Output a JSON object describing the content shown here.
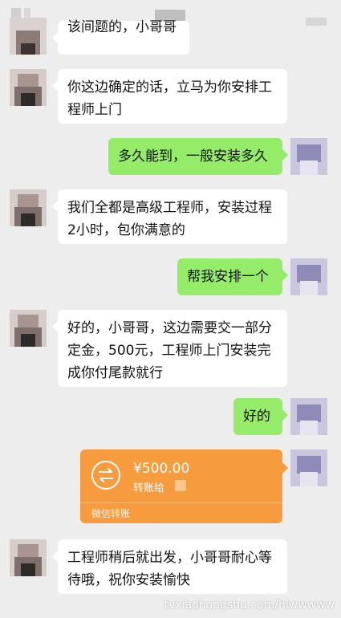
{
  "messages": [
    {
      "id": "m0",
      "side": "left",
      "lines": [
        "该间题的，小哥哥"
      ]
    },
    {
      "id": "m1",
      "side": "left",
      "lines": [
        "你这边确定的话，立马为你安排工",
        "程师上门"
      ]
    },
    {
      "id": "m2",
      "side": "right",
      "lines": [
        "多久能到，一般安装多久"
      ]
    },
    {
      "id": "m3",
      "side": "left",
      "lines": [
        "我们全都是高级工程师，安装过程",
        "2小时，包你满意的"
      ]
    },
    {
      "id": "m4",
      "side": "right",
      "lines": [
        "帮我安排一个"
      ]
    },
    {
      "id": "m5",
      "side": "left",
      "lines": [
        "好的，小哥哥，这边需要交一部分",
        "定金，500元，工程师上门安装完",
        "成你付尾款就行"
      ]
    },
    {
      "id": "m6",
      "side": "right",
      "lines": [
        "好的"
      ]
    },
    {
      "id": "m8",
      "side": "left",
      "lines": [
        "工程师稍后就出发，小哥哥耐心等",
        "待哦，祝你安装愉快"
      ]
    }
  ],
  "transfer": {
    "amount": "¥500.00",
    "to_label": "转账给",
    "footer": "微信转账"
  },
  "watermark": "tvxiaohongshu.com/hlwwwww",
  "colors": {
    "background": "#ededed",
    "bubble_self": "#95ec69",
    "bubble_other": "#ffffff",
    "transfer": "#f79c3e"
  }
}
